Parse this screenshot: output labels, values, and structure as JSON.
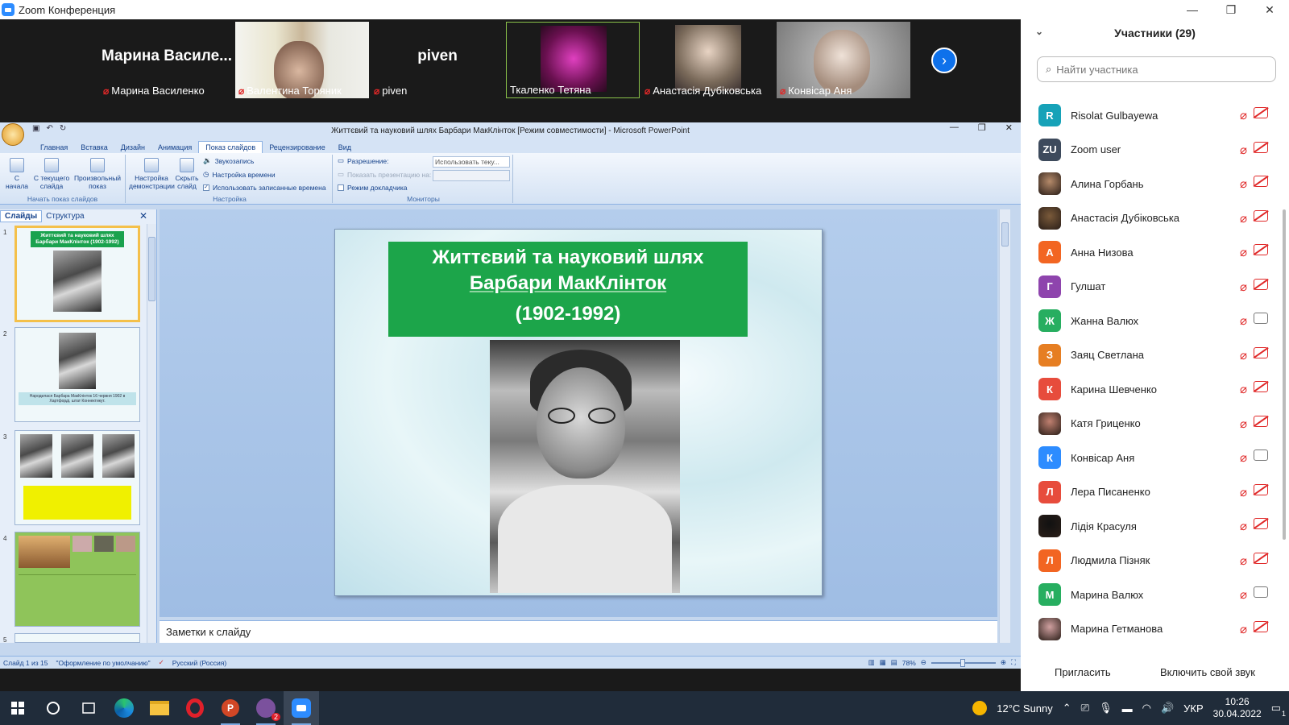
{
  "window": {
    "title": "Zoom Конференция",
    "controls": [
      "—",
      "❐",
      "✕"
    ]
  },
  "gallery": {
    "tiles": [
      {
        "name": "Марина Василенко",
        "big_name": "Марина Василе...",
        "muted": true,
        "video": false
      },
      {
        "name": "Валентина Торяник",
        "muted": true,
        "video": true
      },
      {
        "name": "piven",
        "big_name": "piven",
        "muted": true,
        "video": false
      },
      {
        "name": "Ткаленко Тетяна",
        "muted": false,
        "video": true,
        "active": true
      },
      {
        "name": "Анастасія Дубіковська",
        "muted": true,
        "video": true
      },
      {
        "name": "Конвісар Аня",
        "muted": true,
        "video": true
      }
    ],
    "next_icon": "chevron-right-icon"
  },
  "ppt": {
    "doc_title": "Життєвий та науковий шлях Барбари МакКлінток [Режим совместимости] - Microsoft PowerPoint",
    "tabs": [
      "Главная",
      "Вставка",
      "Дизайн",
      "Анимация",
      "Показ слайдов",
      "Рецензирование",
      "Вид"
    ],
    "active_tab": "Показ слайдов",
    "ribbon": {
      "start_group": {
        "label": "Начать показ слайдов",
        "buttons": [
          "С начала",
          "С текущего слайда",
          "Произвольный показ"
        ]
      },
      "setup_group": {
        "label": "Настройка",
        "buttons": [
          "Настройка демонстрации",
          "Скрыть слайд"
        ],
        "items": [
          "Звукозапись",
          "Настройка времени",
          "Использовать записанные времена"
        ]
      },
      "monitors_group": {
        "label": "Мониторы",
        "resolution_label": "Разрешение:",
        "resolution_value": "Использовать теку...",
        "show_on_label": "Показать презентацию на:",
        "presenter_label": "Режим докладчика"
      }
    },
    "pane_tabs": {
      "slides": "Слайды",
      "outline": "Структура",
      "close": "✕"
    },
    "thumbnails": [
      {
        "num": "1",
        "title": "Життєвий та науковий шлях Барбари МакКлінток (1902-1992)"
      },
      {
        "num": "2",
        "caption": "Народилася Барбара МакКлінток 16 червня 1902 в Хартфорді, штат Коннектикут."
      },
      {
        "num": "3"
      },
      {
        "num": "4"
      },
      {
        "num": "5"
      }
    ],
    "slide": {
      "title_line1": "Життєвий та науковий шлях",
      "title_line2": "Барбари МакКлінток",
      "years": "(1902-1992)"
    },
    "notes_placeholder": "Заметки к слайду",
    "status": {
      "slide_of": "Слайд 1 из 15",
      "theme": "\"Оформление по умолчанию\"",
      "language": "Русский (Россия)",
      "zoom": "78%"
    }
  },
  "participants": {
    "header": "Участники (29)",
    "search_placeholder": "Найти участника",
    "list": [
      {
        "name": "Risolat Gulbayewa",
        "initial": "R",
        "color": "#16a2b8",
        "img": false,
        "cam": "off"
      },
      {
        "name": "Zoom user",
        "initial": "ZU",
        "color": "#3d4a5c",
        "img": false,
        "cam": "off"
      },
      {
        "name": "Алина Горбань",
        "initial": "",
        "color": "#b58a6a",
        "img": true,
        "cam": "off"
      },
      {
        "name": "Анастасія Дубіковська",
        "initial": "",
        "color": "#7a5a3a",
        "img": true,
        "cam": "off"
      },
      {
        "name": "Анна Низова",
        "initial": "А",
        "color": "#f26522",
        "img": false,
        "cam": "off"
      },
      {
        "name": "Гулшат",
        "initial": "Г",
        "color": "#8e44ad",
        "img": false,
        "cam": "off"
      },
      {
        "name": "Жанна Валюх",
        "initial": "Ж",
        "color": "#27ae60",
        "img": false,
        "cam": "on"
      },
      {
        "name": "Заяц Светлана",
        "initial": "З",
        "color": "#e67e22",
        "img": false,
        "cam": "off"
      },
      {
        "name": "Карина Шевченко",
        "initial": "К",
        "color": "#e74c3c",
        "img": false,
        "cam": "off"
      },
      {
        "name": "Катя Гриценко",
        "initial": "",
        "color": "#c08070",
        "img": true,
        "cam": "off"
      },
      {
        "name": "Конвісар Аня",
        "initial": "К",
        "color": "#2d8cff",
        "img": false,
        "cam": "on"
      },
      {
        "name": "Лера Писаненко",
        "initial": "Л",
        "color": "#e74c3c",
        "img": false,
        "cam": "off"
      },
      {
        "name": "Лідія Красуля",
        "initial": "",
        "color": "#111111",
        "img": true,
        "cam": "off"
      },
      {
        "name": "Людмила Пізняк",
        "initial": "Л",
        "color": "#f26522",
        "img": false,
        "cam": "off"
      },
      {
        "name": "Марина Валюх",
        "initial": "М",
        "color": "#27ae60",
        "img": false,
        "cam": "on"
      },
      {
        "name": "Марина Гетманова",
        "initial": "",
        "color": "#d0a0a0",
        "img": true,
        "cam": "off"
      }
    ],
    "invite_label": "Пригласить",
    "unmute_label": "Включить свой звук"
  },
  "taskbar": {
    "apps": [
      "windows-start-icon",
      "search-icon",
      "task-view-icon",
      "edge-icon",
      "file-explorer-icon",
      "opera-icon",
      "powerpoint-icon",
      "viber-icon",
      "zoom-icon"
    ],
    "viber_badge": "2",
    "weather": "12°C  Sunny",
    "lang": "УКР",
    "time": "10:26",
    "date": "30.04.2022",
    "notif_count": "1"
  }
}
